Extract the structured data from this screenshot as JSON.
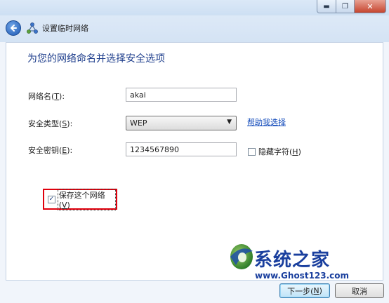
{
  "window": {
    "title": "设置临时网络",
    "caption": {
      "minimize": "▬",
      "maximize": "❐",
      "close": "✕"
    }
  },
  "heading": "为您的网络命名并选择安全选项",
  "fields": {
    "network_name": {
      "label_pre": "网络名(",
      "hotkey": "T",
      "label_post": "):",
      "value": "akai"
    },
    "security_type": {
      "label_pre": "安全类型(",
      "hotkey": "S",
      "label_post": "):",
      "value": "WEP",
      "arrow": "▼"
    },
    "security_key": {
      "label_pre": "安全密钥(",
      "hotkey": "E",
      "label_post": "):",
      "value": "1234567890"
    }
  },
  "help_link": "帮助我选择",
  "hide_chars": {
    "label_pre": "隐藏字符(",
    "hotkey": "H",
    "label_post": ")",
    "checked": false
  },
  "save_network": {
    "label_pre": "保存这个网络(",
    "hotkey": "V",
    "label_post": ")",
    "checked": true,
    "check_glyph": "✓"
  },
  "watermark": {
    "title": "系统之家",
    "url": "www.Ghost123.com"
  },
  "buttons": {
    "next": {
      "label_pre": "下一步(",
      "hotkey": "N",
      "label_post": ")"
    },
    "cancel": "取消"
  },
  "colors": {
    "heading": "#1e3e8c",
    "link": "#0c46b9",
    "highlight_box": "#e0000d"
  }
}
